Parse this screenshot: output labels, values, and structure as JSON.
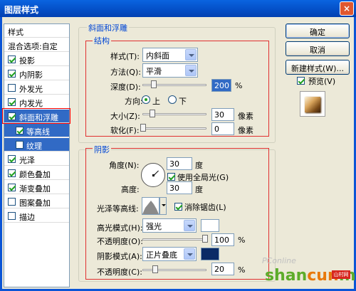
{
  "window": {
    "title": "图层样式",
    "close_glyph": "×"
  },
  "style_list": {
    "header": "样式",
    "blend_options": "混合选项:自定",
    "items": [
      {
        "label": "投影",
        "checked": true
      },
      {
        "label": "内阴影",
        "checked": true
      },
      {
        "label": "外发光",
        "checked": false
      },
      {
        "label": "内发光",
        "checked": true
      },
      {
        "label": "斜面和浮雕",
        "checked": true,
        "selected": true
      },
      {
        "label": "等高线",
        "checked": true,
        "sub": true
      },
      {
        "label": "纹理",
        "checked": false,
        "sub": true
      },
      {
        "label": "光泽",
        "checked": true
      },
      {
        "label": "颜色叠加",
        "checked": true
      },
      {
        "label": "渐变叠加",
        "checked": true
      },
      {
        "label": "图案叠加",
        "checked": false
      },
      {
        "label": "描边",
        "checked": false
      }
    ]
  },
  "bevel": {
    "group_title": "斜面和浮雕",
    "structure_title": "结构",
    "style_label": "样式(T):",
    "style_value": "内斜面",
    "technique_label": "方法(Q):",
    "technique_value": "平滑",
    "depth_label": "深度(D):",
    "depth_value": "200",
    "depth_unit": "%",
    "direction_label": "方向:",
    "direction_up": "上",
    "direction_down": "下",
    "size_label": "大小(Z):",
    "size_value": "30",
    "size_unit": "像素",
    "soften_label": "软化(F):",
    "soften_value": "0",
    "soften_unit": "像素"
  },
  "shading": {
    "title": "阴影",
    "angle_label": "角度(N):",
    "angle_value": "30",
    "angle_unit": "度",
    "global_light": "使用全局光(G)",
    "altitude_label": "高度:",
    "altitude_value": "30",
    "altitude_unit": "度",
    "gloss_label": "光泽等高线:",
    "antialias": "消除锯齿(L)",
    "highlight_mode_label": "高光模式(H):",
    "highlight_mode_value": "强光",
    "highlight_color": "#ffffff",
    "highlight_opacity_label": "不透明度(O):",
    "highlight_opacity_value": "100",
    "highlight_opacity_unit": "%",
    "shadow_mode_label": "阴影模式(A):",
    "shadow_mode_value": "正片叠底",
    "shadow_color": "#0a2a66",
    "shadow_opacity_label": "不透明度(C):",
    "shadow_opacity_value": "20",
    "shadow_opacity_unit": "%"
  },
  "buttons": {
    "ok": "确定",
    "cancel": "取消",
    "new_style": "新建样式(W)...",
    "preview": "预览(V)"
  },
  "watermark": {
    "small": "PConline",
    "text_green": "shan",
    "text_orange": "cun",
    "text_green2": ".net",
    "badge": "山村网"
  }
}
